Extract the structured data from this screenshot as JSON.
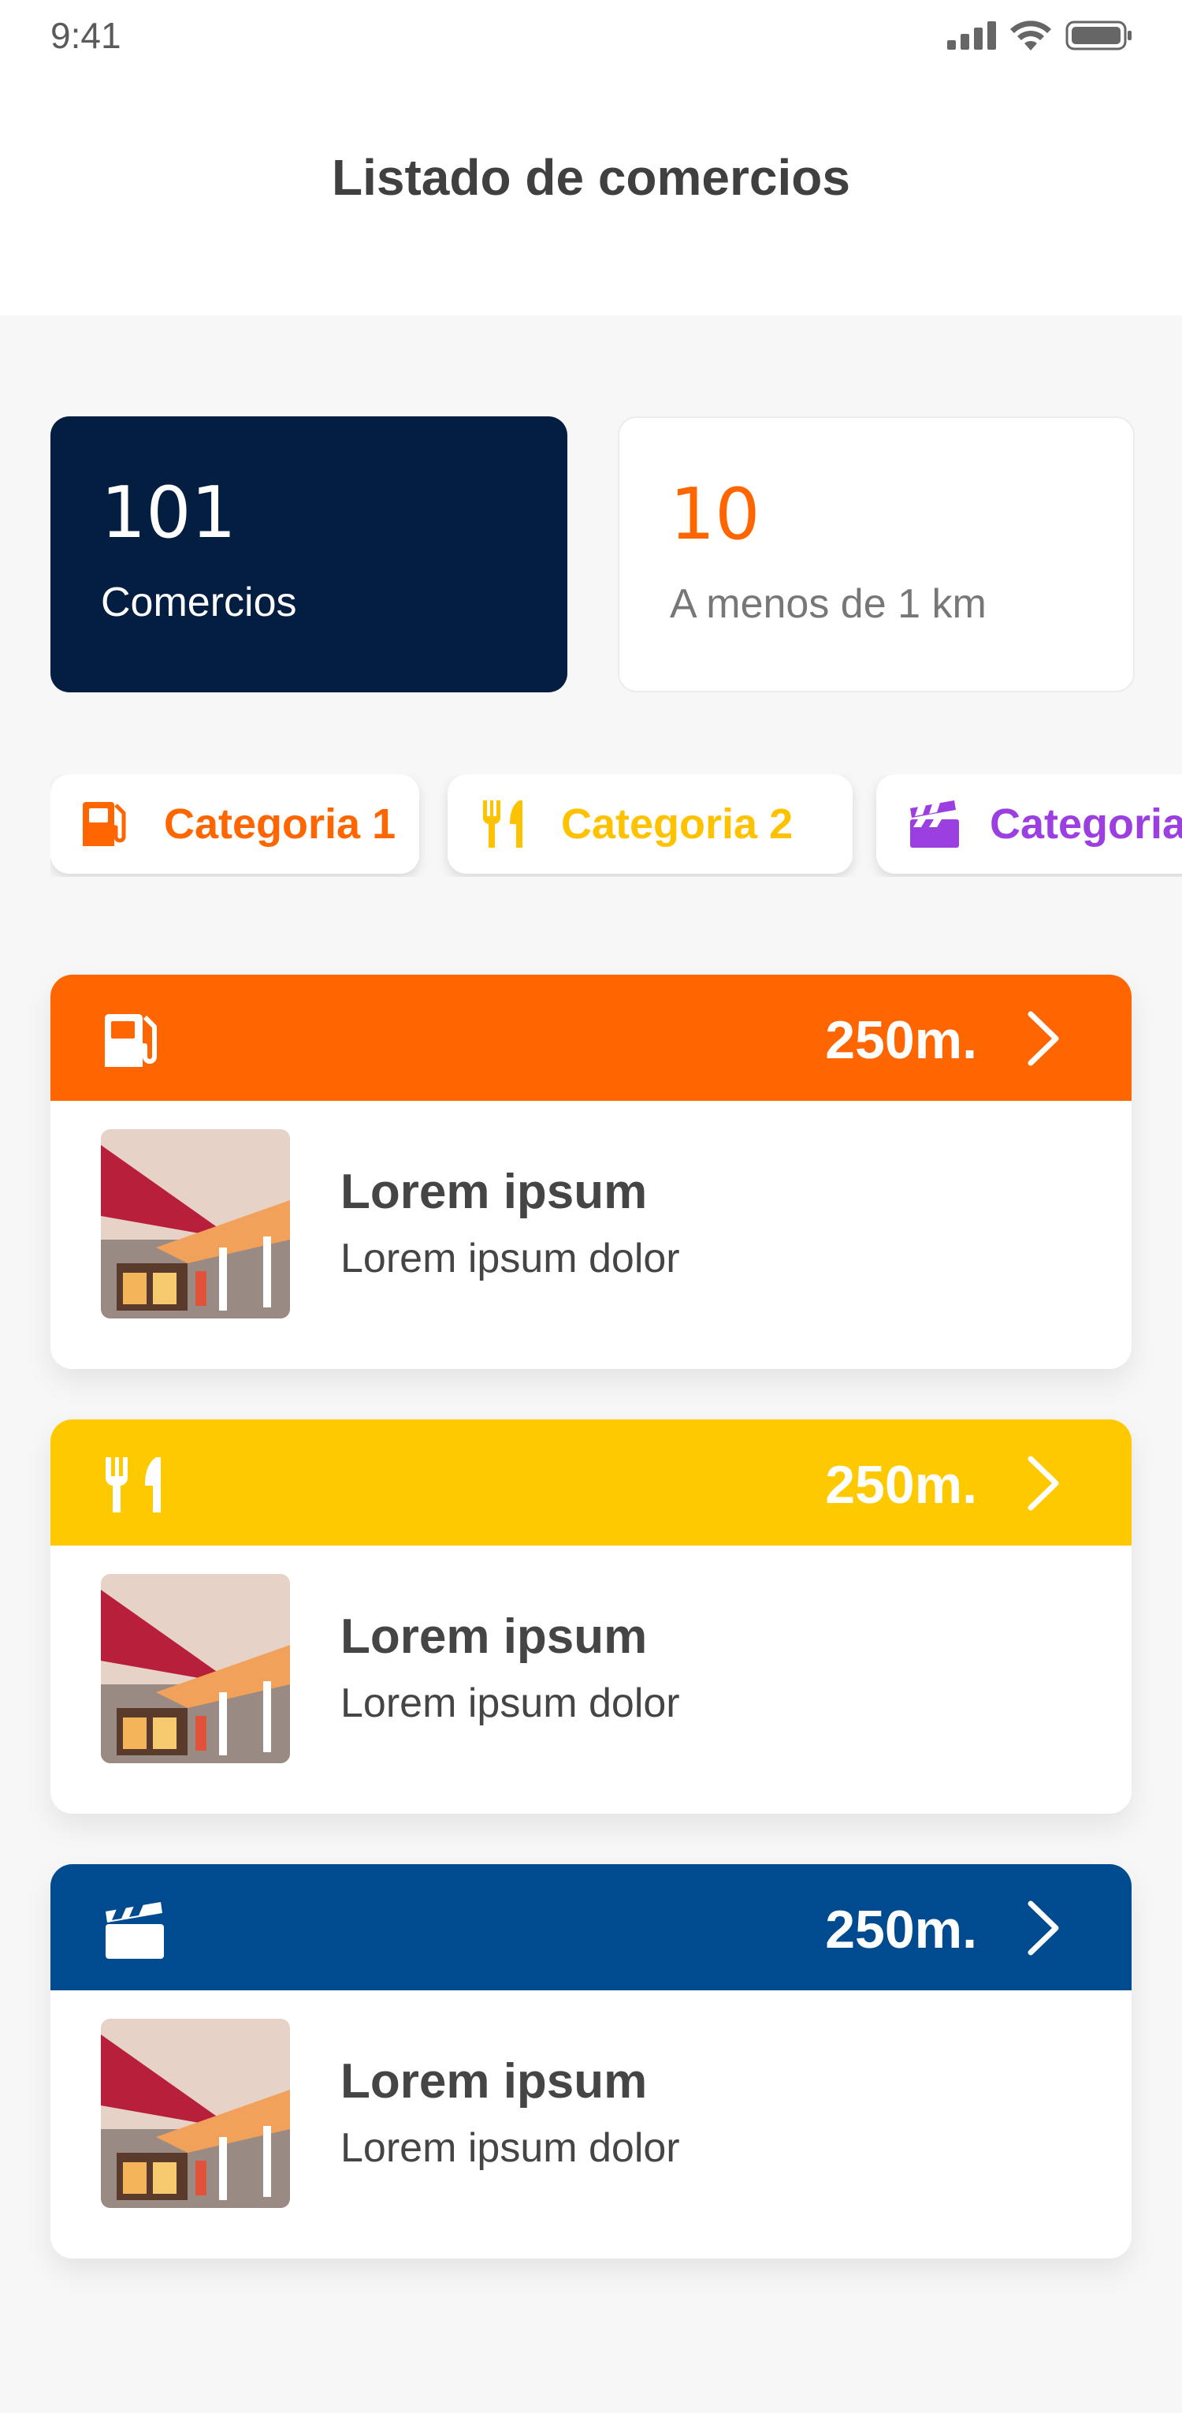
{
  "status_bar": {
    "time": "9:41"
  },
  "header": {
    "title": "Listado de comercios"
  },
  "stats": [
    {
      "value": "101",
      "label": "Comercios"
    },
    {
      "value": "10",
      "label": "A menos de 1 km"
    }
  ],
  "categories": [
    {
      "label": "Categoria 1",
      "icon": "fuel-pump-icon",
      "color": "#ff6600"
    },
    {
      "label": "Categoria 2",
      "icon": "fork-knife-icon",
      "color": "#ffc200"
    },
    {
      "label": "Categoria",
      "icon": "clapperboard-icon",
      "color": "#9b3fe0"
    }
  ],
  "merchants": [
    {
      "icon": "fuel-pump-icon",
      "color": "#ff6600",
      "distance": "250m.",
      "title": "Lorem ipsum",
      "subtitle": "Lorem ipsum dolor"
    },
    {
      "icon": "fork-knife-icon",
      "color": "#ffc900",
      "distance": "250m.",
      "title": "Lorem ipsum",
      "subtitle": "Lorem ipsum dolor"
    },
    {
      "icon": "clapperboard-icon",
      "color": "#004a8f",
      "distance": "250m.",
      "title": "Lorem ipsum",
      "subtitle": "Lorem ipsum dolor"
    }
  ]
}
